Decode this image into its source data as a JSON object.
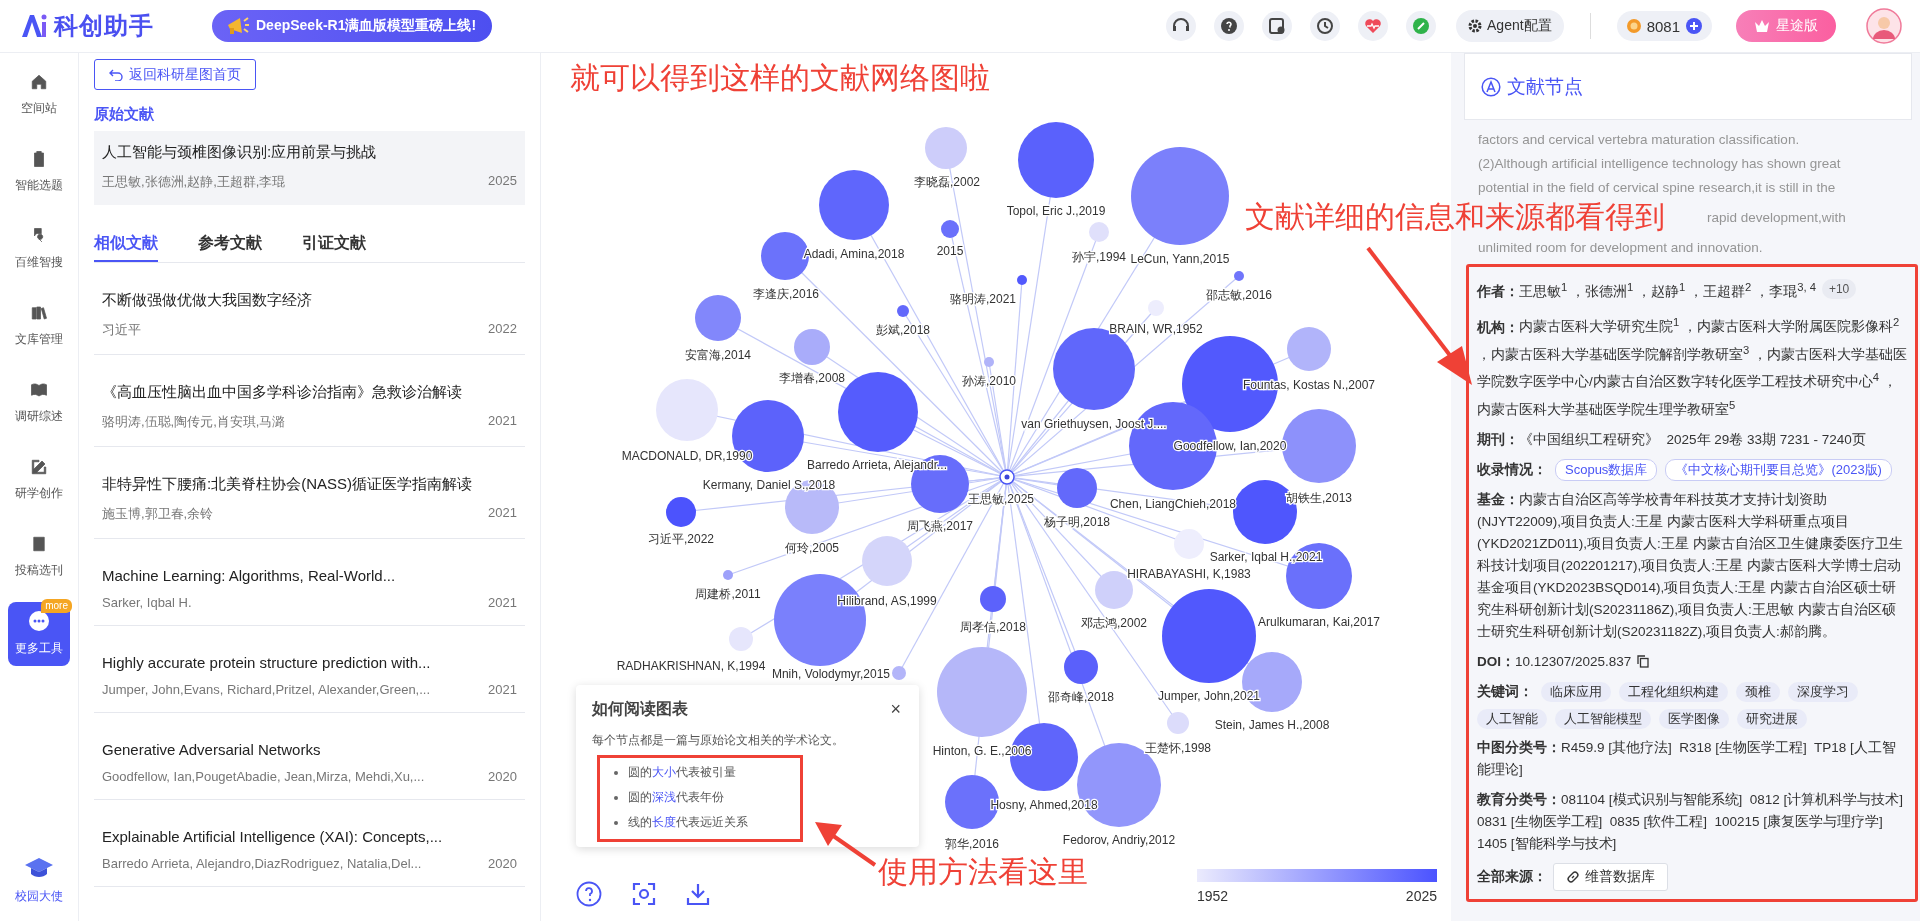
{
  "topbar": {
    "logo_text": "科创助手",
    "banner": "DeepSeek-R1满血版模型重磅上线!",
    "agent_button": "Agent配置",
    "coins": "8081",
    "plan_button": "星途版"
  },
  "rail": {
    "items": [
      {
        "label": "空间站",
        "selected": false
      },
      {
        "label": "智能选题",
        "selected": false
      },
      {
        "label": "百维智搜",
        "selected": false
      },
      {
        "label": "文库管理",
        "selected": false
      },
      {
        "label": "调研综述",
        "selected": false
      },
      {
        "label": "研学创作",
        "selected": false
      },
      {
        "label": "投稿选刊",
        "selected": false
      },
      {
        "label": "更多工具",
        "selected": true,
        "badge": "more"
      }
    ],
    "bottom_item": "校园大使"
  },
  "list_panel": {
    "back_button": "返回科研星图首页",
    "original_heading": "原始文献",
    "original": {
      "title": "人工智能与颈椎图像识别:应用前景与挑战",
      "authors": "王思敏,张德洲,赵静,王超群,李琨",
      "year": "2025"
    },
    "tabs": [
      {
        "label": "相似文献",
        "selected": true
      },
      {
        "label": "参考文献",
        "selected": false
      },
      {
        "label": "引证文献",
        "selected": false
      }
    ],
    "items": [
      {
        "title": "不断做强做优做大我国数字经济",
        "authors": "习近平",
        "year": "2022"
      },
      {
        "title": "《高血压性脑出血中国多学科诊治指南》急救诊治解读",
        "authors": "骆明涛,伍聪,陶传元,肖安琪,马潞",
        "year": "2021"
      },
      {
        "title": "非特异性下腰痛:北美脊柱协会(NASS)循证医学指南解读",
        "authors": "施玉博,郭卫春,余铃",
        "year": "2021"
      },
      {
        "title": "Machine Learning: Algorithms, Real-World...",
        "authors": "Sarker, Iqbal H.",
        "year": "2021"
      },
      {
        "title": "Highly accurate protein structure prediction with...",
        "authors": "Jumper, John,Evans, Richard,Pritzel, Alexander,Green,...",
        "year": "2021"
      },
      {
        "title": "Generative Adversarial Networks",
        "authors": "Goodfellow, Ian,PougetAbadie, Jean,Mirza, Mehdi,Xu,...",
        "year": "2020"
      },
      {
        "title": "Explainable Artificial Intelligence (XAI): Concepts,...",
        "authors": "Barredo Arrieta, Alejandro,DiazRodriguez, Natalia,Del...",
        "year": "2020"
      }
    ]
  },
  "graph": {
    "center": {
      "label": "王思敏,2025"
    },
    "nodes": [
      {
        "label": "李晓磊,2002",
        "color": "#cdcdfa"
      },
      {
        "label": "Adadi, Amina,2018",
        "color": "#5f66fc"
      },
      {
        "label": "李逢庆,2016",
        "color": "#6b72fb"
      },
      {
        "label": "2015",
        "color": "#6a70fb"
      },
      {
        "label": "Topol, Eric J.,2019",
        "color": "#5a61fc"
      },
      {
        "label": "孙宇,1994",
        "color": "#e0e0fb"
      },
      {
        "label": "LeCun, Yann,2015",
        "color": "#7b80fb"
      },
      {
        "label": "骆明涛,2021",
        "color": "#5259fd"
      },
      {
        "label": "邵志敏,2016",
        "color": "#7075fb"
      },
      {
        "label": "彭斌,2018",
        "color": "#6268fb"
      },
      {
        "label": "BRAIN, WR,1952",
        "color": "#ededfd"
      },
      {
        "label": "安富海,2014",
        "color": "#8287fb"
      },
      {
        "label": "李增春,2008",
        "color": "#a9acfa"
      },
      {
        "label": "孙涛,2010",
        "color": "#b0b3f9"
      },
      {
        "label": "Barredo Arrieta, Alejandr...",
        "color": "#555cfd"
      },
      {
        "label": "van Griethuysen, Joost J....",
        "color": "#6067fb"
      },
      {
        "color": "#b1b4fa"
      },
      {
        "label": "Fountas, Kostas N.,2007",
        "color": "#5259fd"
      },
      {
        "label": "MACDONALD, DR,1990",
        "color": "#e6e6fc"
      },
      {
        "label": "Kermany, Daniel S.,2018",
        "color": "#5c62fb"
      },
      {
        "label": "Goodfellow, Ian,2020",
        "color": "#6368fb"
      },
      {
        "label": "胡铁生,2013",
        "color": "#8d91fb"
      },
      {
        "label": "习近平,2022",
        "color": "#4c53fd"
      },
      {
        "label": "何玲,2005",
        "color": "#b8baf9"
      },
      {
        "label": "周飞燕,2017",
        "color": "#676dfb"
      },
      {
        "label": "杨子明,2018",
        "color": "#6369fb"
      },
      {
        "label": "Chen, LiangChieh,2018",
        "color": "#4f56fd"
      },
      {
        "label": "HIRABAYASHI, K,1983",
        "color": "#eeeefd"
      },
      {
        "label": "Sarker, Iqbal H.,2021"
      },
      {
        "label": "邓志鸿,2002",
        "color": "#cfd0fa"
      },
      {
        "label": "Arulkumaran, Kai,2017",
        "color": "#6a70fb"
      },
      {
        "label": "周建桥,2011",
        "color": "#9ea1fa"
      },
      {
        "color": "#d4d5fa"
      },
      {
        "label": "Hilibrand, AS,1999",
        "color": "#7a80fc"
      },
      {
        "label": "周孝信,2018",
        "color": "#5c62fb"
      },
      {
        "label": "邵奇峰,2018",
        "color": "#5a60fb"
      },
      {
        "label": "Jumper, John,2021",
        "color": "#5158fd"
      },
      {
        "label": "Stein, James H.,2008",
        "color": "#a6a9fa"
      },
      {
        "label": "RADHAKRISHNAN, K,1994",
        "color": "#e6e6fc"
      },
      {
        "label": "Mnih, Volodymyr,2015",
        "color": "#b3b5f9"
      },
      {
        "label": "Hinton, G. E.,2006",
        "color": "#b5b7f9"
      },
      {
        "label": "王楚怀,1998",
        "color": "#dcdcfb"
      },
      {
        "label": "Hosny, Ahmed,2018",
        "color": "#5f65fb"
      },
      {
        "label": "郭华,2016",
        "color": "#6b71fb"
      },
      {
        "label": "Fedorov, Andriy,2012",
        "color": "#9296fb"
      }
    ],
    "help": {
      "title": "如何阅读图表",
      "close": "×",
      "intro": "每个节点都是一篇与原始论文相关的学术论文。",
      "bullets": [
        {
          "before": "圆的",
          "highlight": "大小",
          "after": "代表被引量"
        },
        {
          "before": "圆的",
          "highlight": "深浅",
          "after": "代表年份"
        },
        {
          "before": "线的",
          "highlight": "长度",
          "after": "代表远近关系"
        }
      ]
    },
    "legend": {
      "min": "1952",
      "max": "2025"
    }
  },
  "detail": {
    "header": "文献节点",
    "abstract_lines": [
      "factors and cervical vertebra maturation classification.",
      "(2)Although artificial intelligence technology has shown great",
      "potential in the field of cervical spine research,it is still in the",
      "rapid development,with",
      "unlimited room for development and innovation."
    ],
    "fields": [
      {
        "kind": "text",
        "label": "作者：",
        "value": "王思敏$^{1}$ ，张德洲$^{1}$ ，赵静$^{1}$ ，王超群$^{2}$ ，李琨$^{3, 4}$",
        "badge": "+10"
      },
      {
        "kind": "text",
        "label": "机构：",
        "value": "内蒙古医科大学研究生院$^{1}$ ，内蒙古医科大学附属医院影像科$^{2}$ ，内蒙古医科大学基础医学院解剖学教研室$^{3}$ ，内蒙古医科大学基础医学院数字医学中心/内蒙古自治区数字转化医学工程技术研究中心$^{4}$ ，内蒙古医科大学基础医学院生理学教研室$^{5}$"
      },
      {
        "kind": "text",
        "label": "期刊：",
        "value": "《中国组织工程研究》  2025年 29卷 33期 7231 - 7240页"
      },
      {
        "kind": "outline_tags",
        "label": "收录情况：",
        "tags": [
          "Scopus数据库",
          "《中文核心期刊要目总览》(2023版)"
        ]
      },
      {
        "kind": "text",
        "label": "基金：",
        "value": "内蒙古自治区高等学校青年科技英才支持计划资助(NJYT22009),项目负责人:王星 内蒙古医科大学科研重点项目(YKD2021ZD011),项目负责人:王星 内蒙古自治区卫生健康委医疗卫生科技计划项目(202201217),项目负责人:王星 内蒙古医科大学博士启动基金项目(YKD2023BSQD014),项目负责人:王星 内蒙古自治区硕士研究生科研创新计划(S20231186Z),项目负责人:王思敏 内蒙古自治区硕士研究生科研创新计划(S20231182Z),项目负责人:郝韵腾。"
      },
      {
        "kind": "copy",
        "label": "DOI：",
        "value": "10.12307/2025.837"
      },
      {
        "kind": "tags",
        "label": "关键词：",
        "tags": [
          "临床应用",
          "工程化组织构建",
          "颈椎",
          "深度学习",
          "人工智能",
          "人工智能模型",
          "医学图像",
          "研究进展"
        ]
      },
      {
        "kind": "text",
        "label": "中图分类号：",
        "value": "R459.9 [其他疗法]  R318 [生物医学工程]  TP18 [人工智能理论]"
      },
      {
        "kind": "text",
        "label": "教育分类号：",
        "value": "081104 [模式识别与智能系统]  0812 [计算机科学与技术]  0831 [生物医学工程]  0835 [软件工程]  100215 [康复医学与理疗学]  1405 [智能科学与技术]"
      },
      {
        "kind": "link",
        "label": "全部来源：",
        "button": "维普数据库"
      }
    ]
  },
  "annotations": [
    "就可以得到这样的文献网络图啦",
    "文献详细的信息和来源都看得到",
    "使用方法看这里"
  ]
}
